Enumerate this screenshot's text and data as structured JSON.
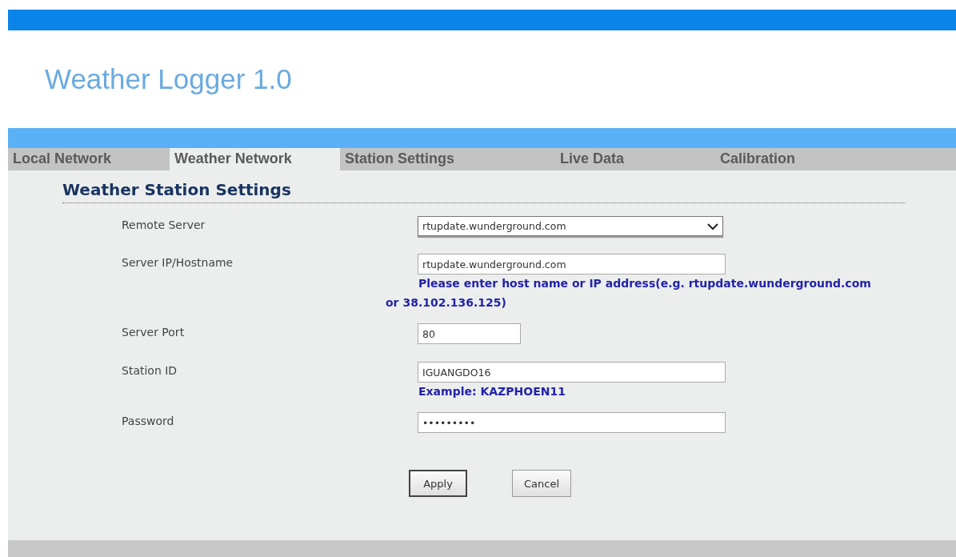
{
  "header": {
    "title": "Weather Logger 1.0"
  },
  "tabs": [
    {
      "label": "Local Network",
      "selected": false
    },
    {
      "label": "Weather Network",
      "selected": true
    },
    {
      "label": "Station Settings",
      "selected": false
    },
    {
      "label": "Live Data",
      "selected": false
    },
    {
      "label": "Calibration",
      "selected": false
    }
  ],
  "section": {
    "title": "Weather Station Settings"
  },
  "fields": [
    {
      "label": "Remote Server",
      "kind": "select",
      "value": "rtupdate.wunderground.com"
    },
    {
      "label": "Server IP/Hostname",
      "kind": "text",
      "value": "rtupdate.wunderground.com",
      "hint": "Please enter host name or IP address(e.g. rtupdate.wunderground.com or 38.102.136.125)"
    },
    {
      "label": "Server Port",
      "kind": "short",
      "value": "80"
    },
    {
      "label": "Station ID",
      "kind": "text",
      "value": "IGUANGDO16",
      "hint": "Example: KAZPHOEN11"
    },
    {
      "label": "Password",
      "kind": "text",
      "value": "•••••••••"
    }
  ],
  "buttons": [
    {
      "label": "Apply",
      "kind": "default"
    },
    {
      "label": "Cancel",
      "kind": "plain"
    }
  ]
}
